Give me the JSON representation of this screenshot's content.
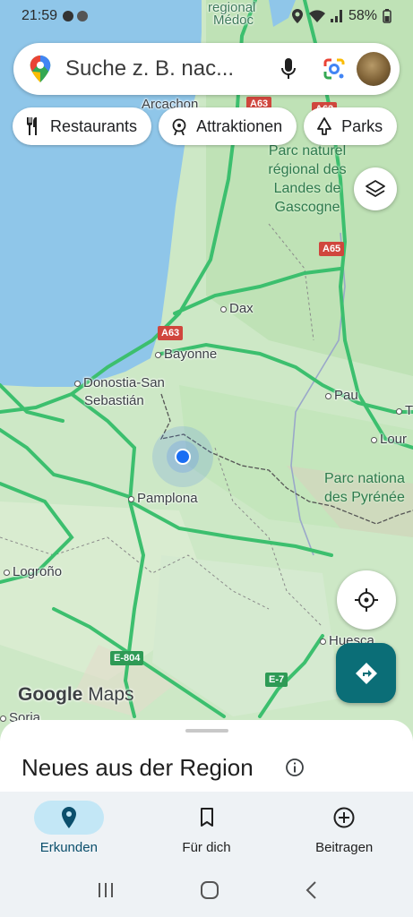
{
  "status_bar": {
    "time": "21:59",
    "battery": "58%"
  },
  "search": {
    "placeholder": "Suche z. B. nac..."
  },
  "chips": [
    {
      "label": "Restaurants",
      "icon": "fork-knife-icon"
    },
    {
      "label": "Attraktionen",
      "icon": "attractions-icon"
    },
    {
      "label": "Parks",
      "icon": "tree-icon"
    }
  ],
  "map": {
    "places": {
      "medoc": "Médoc",
      "regional": "regional",
      "arcachon": "Arcachon",
      "dax": "Dax",
      "bayonne": "Bayonne",
      "donostia": "Donostia-San",
      "sebastian": "Sebastián",
      "pau": "Pau",
      "lourdes": "Lour",
      "tarbes": "T",
      "pamplona": "Pamplona",
      "logrono": "Logroño",
      "huesca": "Huesca",
      "soria": "Soria"
    },
    "parks": {
      "landes": [
        "Parc naturel",
        "régional des",
        "Landes de",
        "Gascogne"
      ],
      "pyrenees": [
        "Parc nationa",
        "des Pyrénée"
      ]
    },
    "roads": {
      "a63_top": "A63",
      "a62": "A62",
      "a63_top2": "A63",
      "a65": "A65",
      "a63": "A63",
      "e804": "E-804",
      "e7": "E-7"
    },
    "logo": {
      "google": "Google",
      "maps": "Maps"
    }
  },
  "sheet": {
    "title": "Neues aus der Region"
  },
  "nav": {
    "items": [
      {
        "label": "Erkunden",
        "icon": "explore-pin-icon",
        "active": true
      },
      {
        "label": "Für dich",
        "icon": "bookmark-icon",
        "active": false
      },
      {
        "label": "Beitragen",
        "icon": "add-circle-icon",
        "active": false
      }
    ]
  },
  "colors": {
    "water": "#8fc6e9",
    "land": "#cfe9c9",
    "highway": "#3cbf6e",
    "accent": "#0b6e77",
    "active_pill": "#c3e7f6"
  }
}
